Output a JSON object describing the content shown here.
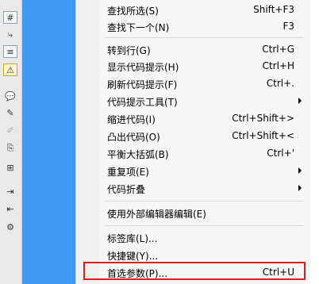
{
  "toolbar": {
    "buttons": [
      {
        "name": "format-icon",
        "glyph": "#"
      },
      {
        "name": "wrap-icon",
        "glyph": "⤷"
      },
      {
        "name": "indent-icon",
        "glyph": "≡"
      },
      {
        "name": "warning-icon",
        "glyph": "⚠"
      },
      {
        "name": "comment-icon",
        "glyph": "💬"
      },
      {
        "name": "comment-remove-icon",
        "glyph": "✎"
      },
      {
        "name": "brush-icon",
        "glyph": "✐"
      },
      {
        "name": "snippet-icon",
        "glyph": "⎘"
      },
      {
        "name": "tree-icon",
        "glyph": "⊞"
      },
      {
        "name": "indent-more-icon",
        "glyph": "⇥"
      },
      {
        "name": "outdent-icon",
        "glyph": "⇤"
      },
      {
        "name": "tools-icon",
        "glyph": "⚙"
      }
    ]
  },
  "menu": {
    "items": [
      {
        "label": "查找所选(S)",
        "shortcut": "Shift+F3"
      },
      {
        "label": "查找下一个(N)",
        "shortcut": "F3"
      },
      {
        "label": "转到行(G)",
        "shortcut": "Ctrl+G"
      },
      {
        "label": "显示代码提示(H)",
        "shortcut": "Ctrl+H"
      },
      {
        "label": "刷新代码提示(F)",
        "shortcut": "Ctrl+."
      },
      {
        "label": "代码提示工具(T)",
        "shortcut": ""
      },
      {
        "label": "缩进代码(I)",
        "shortcut": "Ctrl+Shift+>"
      },
      {
        "label": "凸出代码(O)",
        "shortcut": "Ctrl+Shift+<"
      },
      {
        "label": "平衡大括弧(B)",
        "shortcut": "Ctrl+'"
      },
      {
        "label": "重复项(E)",
        "shortcut": ""
      },
      {
        "label": "代码折叠",
        "shortcut": ""
      },
      {
        "label": "使用外部编辑器编辑(E)",
        "shortcut": ""
      },
      {
        "label": "标签库(L)...",
        "shortcut": ""
      },
      {
        "label": "快捷键(Y)...",
        "shortcut": ""
      },
      {
        "label": "首选参数(P)...",
        "shortcut": "Ctrl+U"
      }
    ]
  },
  "colors": {
    "accent_blue": "#3f9bf2",
    "highlight_red": "#e01b1b"
  }
}
